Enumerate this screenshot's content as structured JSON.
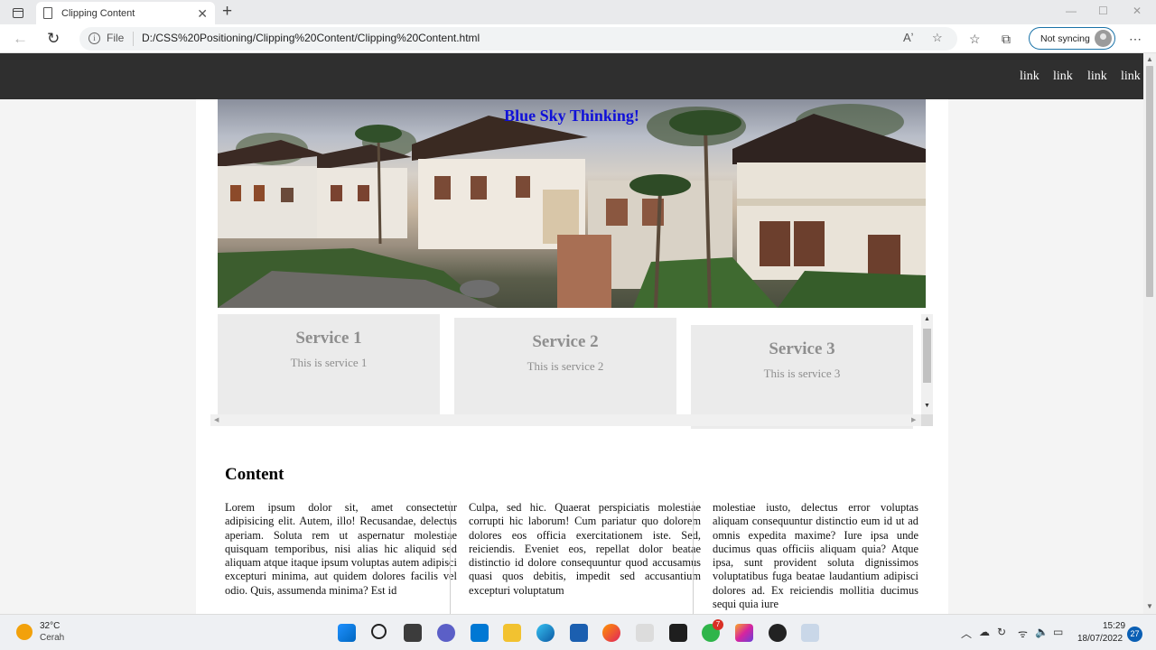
{
  "browser": {
    "tab_title": "Clipping Content",
    "tab_close": "✕",
    "new_tab": "+",
    "address_scheme": "File",
    "url": "D:/CSS%20Positioning/Clipping%20Content/Clipping%20Content.html",
    "sync_label": "Not syncing",
    "icons": [
      "tab-actions-icon",
      "back-icon",
      "refresh-icon",
      "info-icon",
      "read-aloud-icon",
      "favorite-add-icon",
      "favorites-icon",
      "collections-icon",
      "more-icon"
    ]
  },
  "page": {
    "nav_links": [
      "link",
      "link",
      "link",
      "link"
    ],
    "hero_title": "Blue Sky Thinking!",
    "services": [
      {
        "title": "Service 1",
        "text": "This is service 1"
      },
      {
        "title": "Service 2",
        "text": "This is service 2"
      },
      {
        "title": "Service 3",
        "text": "This is service 3"
      }
    ],
    "content_heading": "Content",
    "columns": [
      "Lorem ipsum dolor sit, amet consectetur adipisicing elit. Autem, illo! Recusandae, delectus aperiam. Soluta rem ut aspernatur molestiae quisquam temporibus, nisi alias hic aliquid sed aliquam atque itaque ipsum voluptas autem adipisci excepturi minima, aut quidem dolores facilis vel odio. Quis, assumenda minima? Est id",
      "Culpa, sed hic. Quaerat perspiciatis molestiae corrupti hic laborum! Cum pariatur quo dolorem dolores eos officia exercitationem iste. Sed, reiciendis. Eveniet eos, repellat dolor beatae distinctio id dolore consequuntur quod accusamus quasi quos debitis, impedit sed accusantium excepturi voluptatum",
      "molestiae iusto, delectus error voluptas aliquam consequuntur distinctio eum id ut ad omnis expedita maxime? Iure ipsa unde ducimus quas officiis aliquam quia? Atque ipsa, sunt provident soluta dignissimos voluptatibus fuga beatae laudantium adipisci dolores ad. Ex reiciendis mollitia ducimus sequi quia iure"
    ]
  },
  "taskbar": {
    "temperature": "32°C",
    "weather": "Cerah",
    "time": "15:29",
    "date": "18/07/2022",
    "whatsapp_badge": "7",
    "notifications": "27",
    "apps": [
      "start-icon",
      "search-icon",
      "file-explorer-icon",
      "teams-chat-icon",
      "vscode-icon",
      "folder-icon",
      "edge-icon",
      "store-icon",
      "firefox-icon",
      "amazon-icon",
      "dropbox-icon",
      "whatsapp-icon",
      "instagram-icon",
      "media-player-icon",
      "snipping-tool-icon"
    ]
  }
}
